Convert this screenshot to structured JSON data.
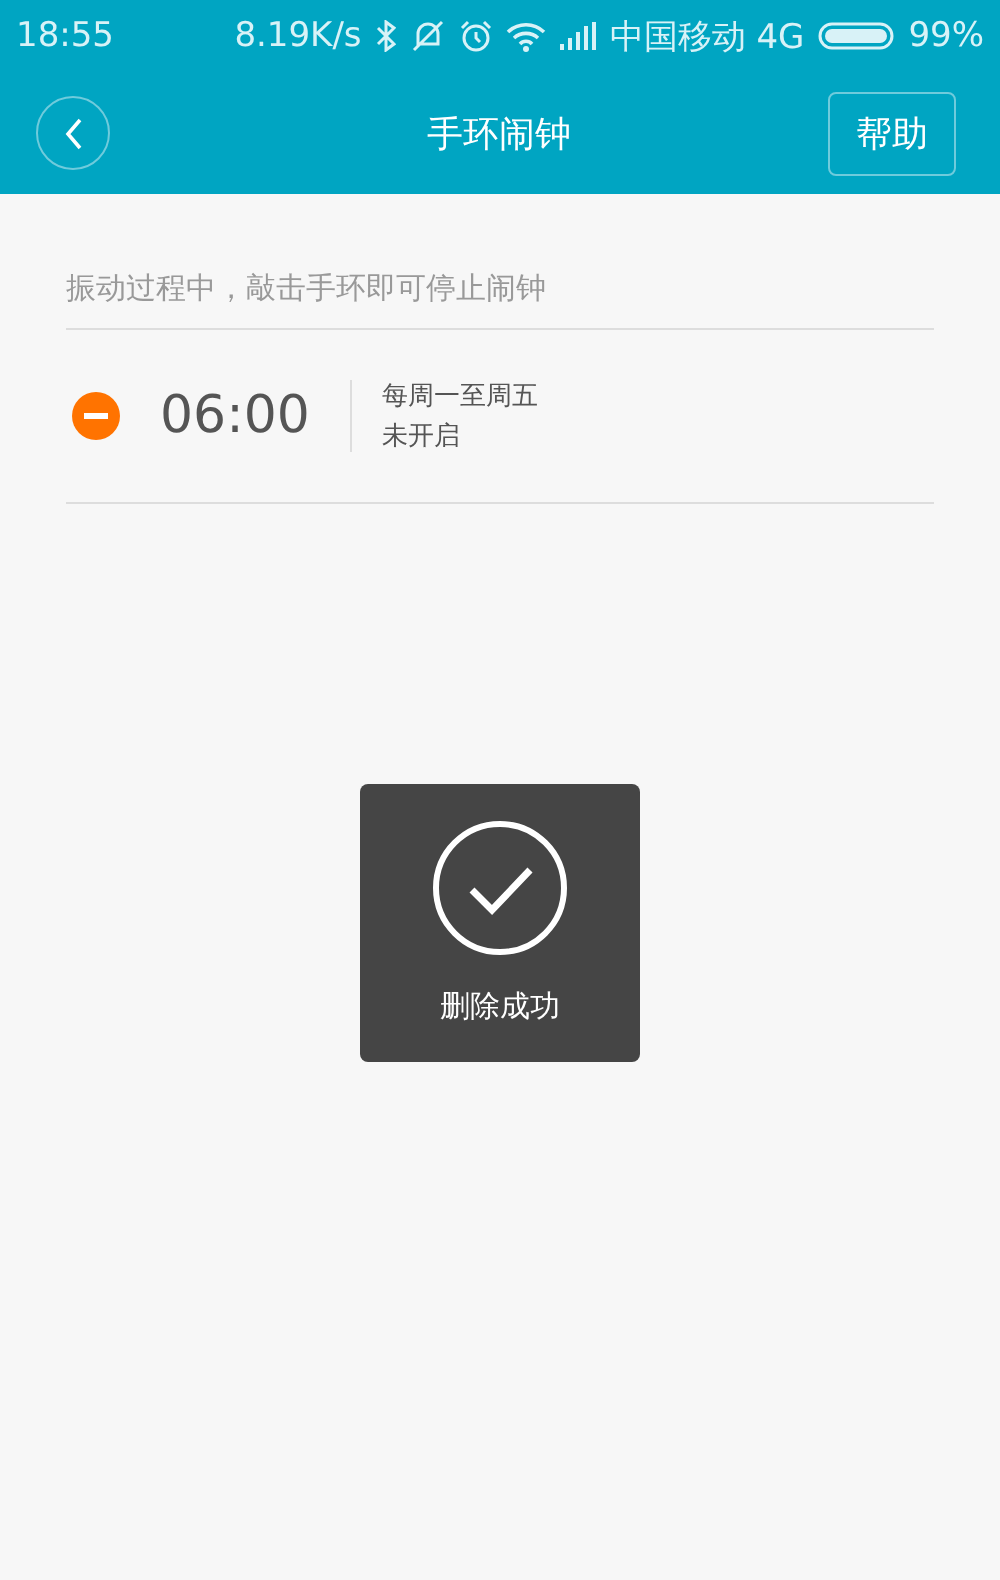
{
  "status_bar": {
    "time": "18:55",
    "speed": "8.19K/s",
    "carrier": "中国移动 4G",
    "battery": "99%"
  },
  "header": {
    "title": "手环闹钟",
    "help_button": "帮助"
  },
  "hint": "振动过程中，敲击手环即可停止闹钟",
  "alarms": [
    {
      "time": "06:00",
      "repeat": "每周一至周五",
      "status": "未开启",
      "enabled": false
    }
  ],
  "toast": {
    "message": "删除成功"
  }
}
